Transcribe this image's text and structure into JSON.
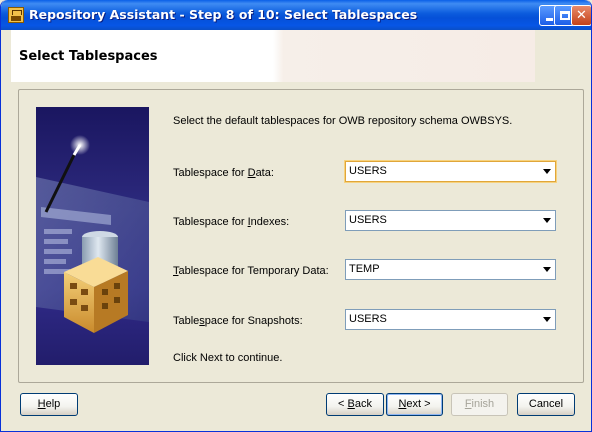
{
  "window": {
    "title": "Repository Assistant - Step 8 of 10: Select Tablespaces"
  },
  "header": {
    "title": "Select Tablespaces"
  },
  "main": {
    "intro": "Select the default tablespaces for OWB repository schema OWBSYS.",
    "rows": [
      {
        "label_pre": "Tablespace for ",
        "label_u": "D",
        "label_post": "ata:",
        "value": "USERS"
      },
      {
        "label_pre": "Tablespace for ",
        "label_u": "I",
        "label_post": "ndexes:",
        "value": "USERS"
      },
      {
        "label_pre": "",
        "label_u": "T",
        "label_post": "ablespace for Temporary Data:",
        "value": "TEMP"
      },
      {
        "label_pre": "Table",
        "label_u": "s",
        "label_post": "pace for Snapshots:",
        "value": "USERS"
      }
    ],
    "note": "Click Next to continue."
  },
  "buttons": {
    "help": {
      "u": "H",
      "rest": "elp"
    },
    "back": {
      "pre": "< ",
      "u": "B",
      "rest": "ack"
    },
    "next": {
      "u": "N",
      "rest": "ext >"
    },
    "finish": {
      "u": "F",
      "rest": "inish"
    },
    "cancel": "Cancel"
  }
}
